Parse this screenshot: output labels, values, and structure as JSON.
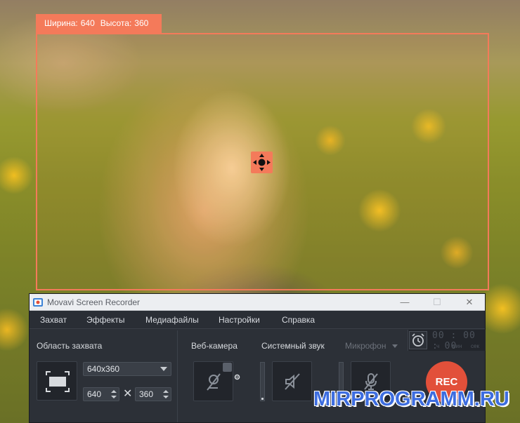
{
  "capture": {
    "width_label": "Ширина:",
    "width_value": "640",
    "height_label": "Высота:",
    "height_value": "360"
  },
  "window": {
    "title": "Movavi Screen Recorder",
    "minimize": "—",
    "maximize": "☐",
    "close": "✕"
  },
  "menu": {
    "items": [
      "Захват",
      "Эффекты",
      "Медиафайлы",
      "Настройки",
      "Справка"
    ]
  },
  "area": {
    "label": "Область захвата",
    "preset": "640x360",
    "width": "640",
    "height": "360",
    "times": "✕"
  },
  "devices": {
    "webcam_label": "Веб-камера",
    "system_sound_label": "Системный звук",
    "microphone_label": "Микрофон"
  },
  "timer": {
    "value": "00 : 00 : 00",
    "units": [
      "ч",
      "мин",
      "сек"
    ]
  },
  "rec": {
    "label": "REC"
  },
  "watermark": "MIRPROGRAMM.RU",
  "colors": {
    "accent": "#f47a5a",
    "rec": "#e2503a",
    "panel": "#2c3037",
    "watermark": "#3d6de0"
  }
}
